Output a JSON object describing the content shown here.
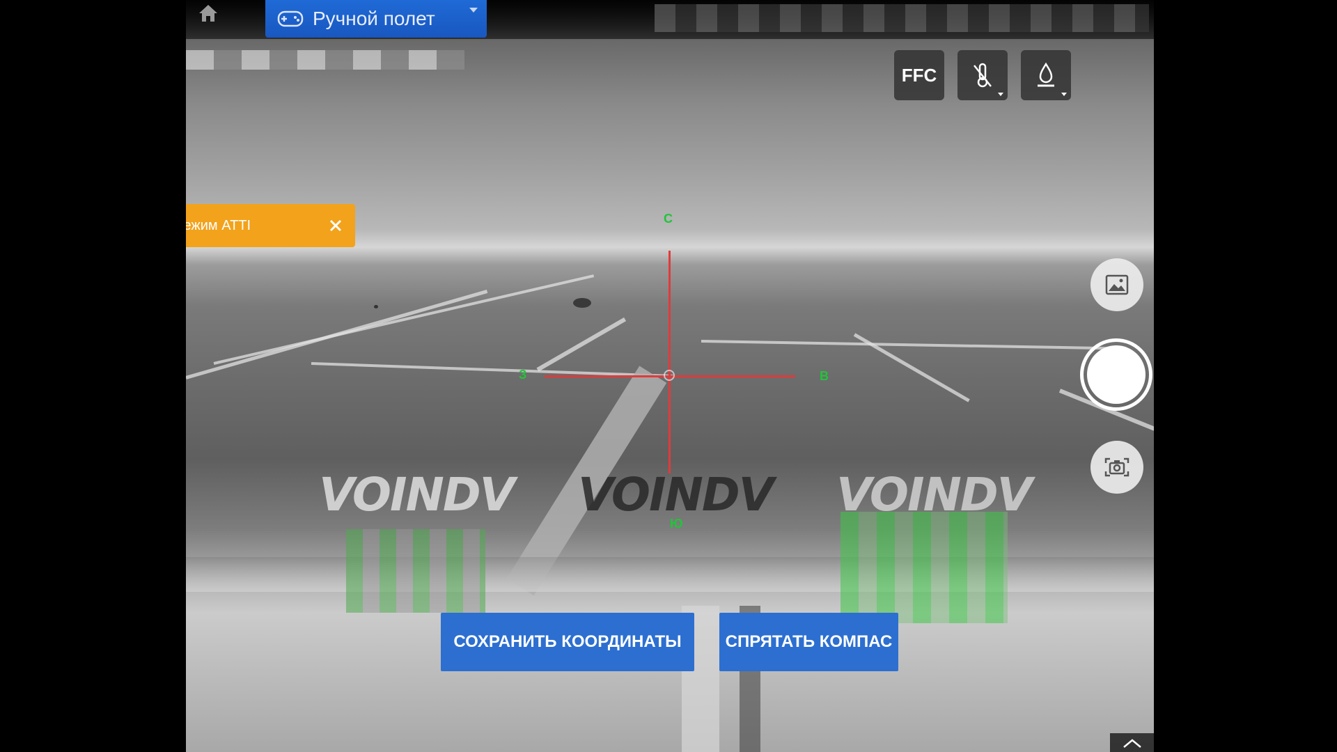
{
  "top_bar": {
    "mode_label": "Ручной полет",
    "home_icon": "home-icon",
    "controller_icon": "gamepad-icon"
  },
  "camera_controls": {
    "ffc_label": "FFC",
    "temperature_icon": "thermometer-off-icon",
    "palette_icon": "drop-icon"
  },
  "warning": {
    "text": "Режим ATTI",
    "close_icon": "close-icon"
  },
  "compass": {
    "north": "С",
    "south": "Ю",
    "west": "З",
    "east": "В"
  },
  "watermark": {
    "text": "VOINDV"
  },
  "right_panel": {
    "gallery_icon": "gallery-icon",
    "shutter": "shutter-button",
    "switch_camera_icon": "camera-switch-icon"
  },
  "actions": {
    "save_coordinates": "СОХРАНИТЬ КООРДИНАТЫ",
    "hide_compass": "СПРЯТАТЬ КОМПАС"
  },
  "colors": {
    "accent_blue": "#2c6fd0",
    "warning_orange": "#f3a21b",
    "crosshair_red": "#e23a3a",
    "compass_green": "#22c43a"
  }
}
